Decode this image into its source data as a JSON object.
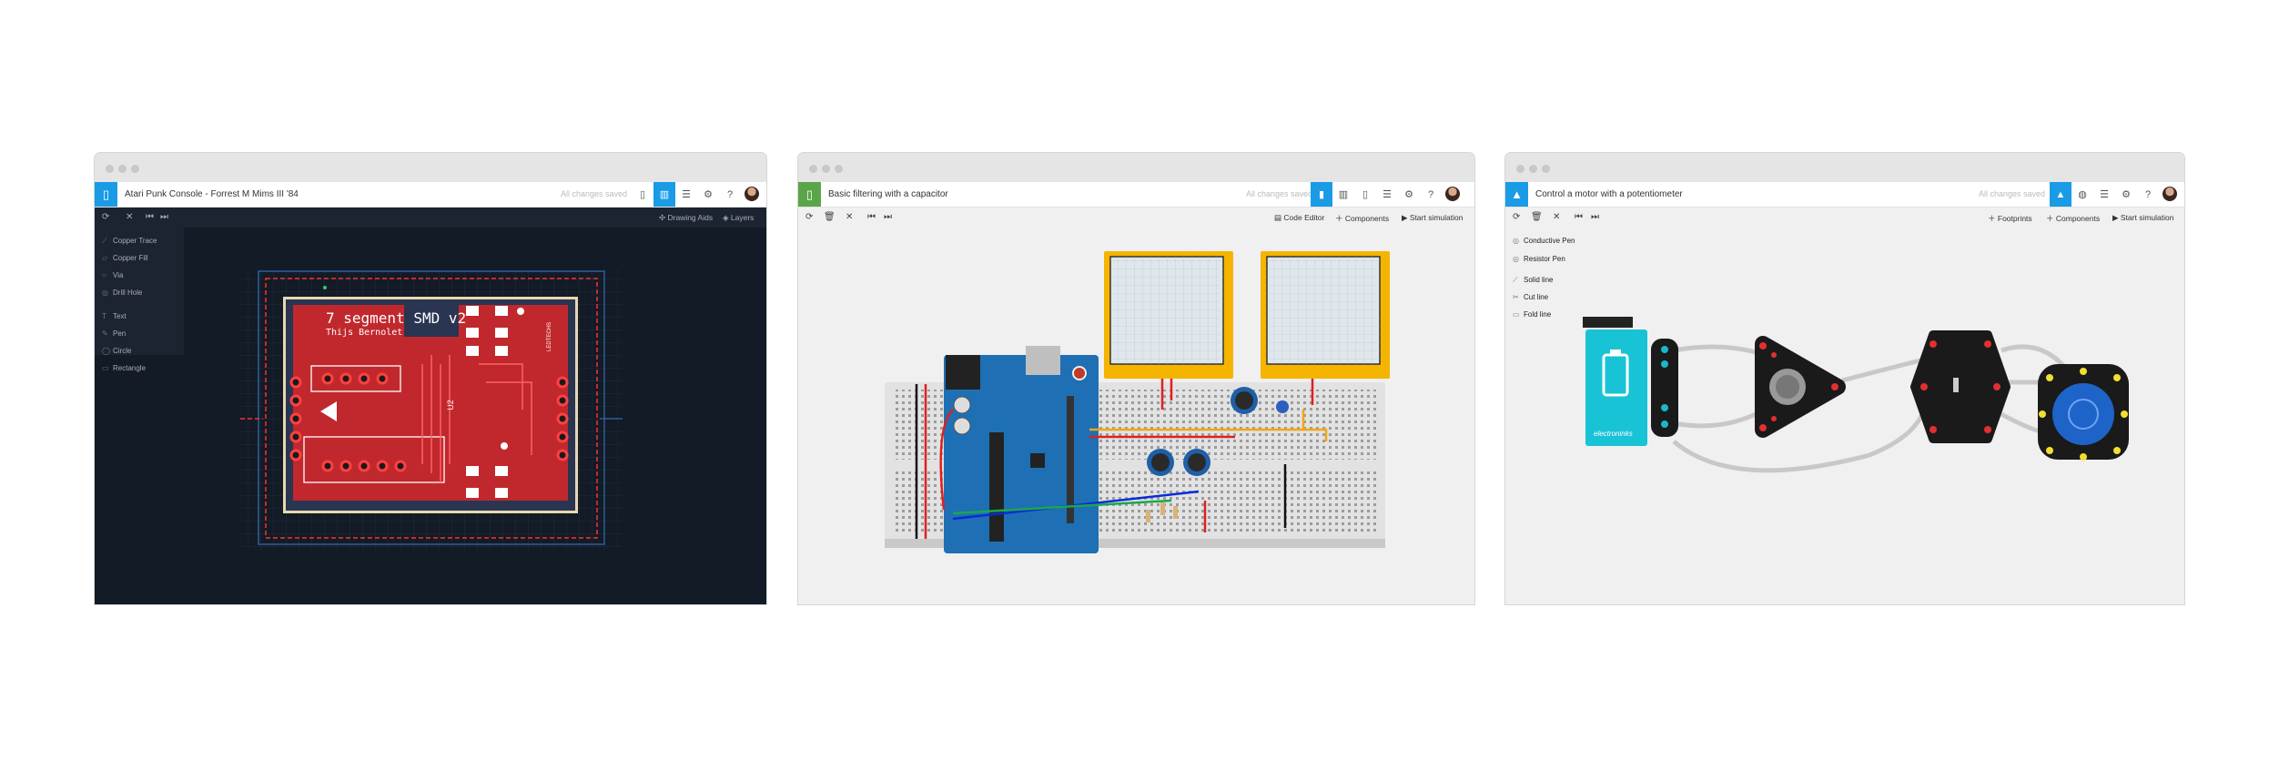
{
  "pcb": {
    "title": "Atari Punk Console - Forrest M Mims III '84",
    "saved": "All changes saved",
    "toolbar_right": [
      "Drawing Aids",
      "Layers"
    ],
    "tools": [
      "Copper Trace",
      "Copper Fill",
      "Via",
      "Drill Hole",
      "Text",
      "Pen",
      "Circle",
      "Rectangle"
    ],
    "board_title": "7 segment SMD v2",
    "board_author": "Thijs Bernolet",
    "board_side_label": "LEDTECHS",
    "chip_label": "U2"
  },
  "breadboard": {
    "title": "Basic filtering with a capacitor",
    "saved": "All changes saved",
    "toolbar_right": [
      "Code Editor",
      "Components",
      "Start simulation"
    ]
  },
  "paper": {
    "title": "Control a motor with a potentiometer",
    "saved": "All changes saved",
    "toolbar_right": [
      "Footprints",
      "Components",
      "Start simulation"
    ],
    "tools": [
      "Conductive Pen",
      "Resistor Pen",
      "Solid line",
      "Cut line",
      "Fold line"
    ],
    "battery_brand": "electroninks"
  },
  "colors": {
    "accent": "#1a9be6",
    "pcb_bg": "#121b26",
    "copper": "#d32b2b",
    "green_logo": "#5aa54a"
  }
}
